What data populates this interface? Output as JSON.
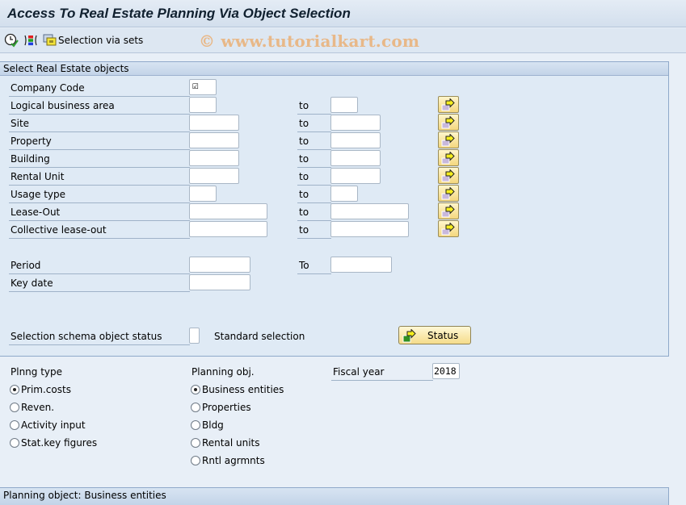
{
  "window": {
    "title": "Access To Real Estate Planning Via Object Selection"
  },
  "toolbar": {
    "execute_icon": "clock-check-icon",
    "selection_options_icon": "multicolor-selection-icon",
    "sets_icon": "selection-sets-icon",
    "selection_via_sets_label": "Selection via sets",
    "watermark": "© www.tutorialkart.com"
  },
  "select_objects": {
    "header": "Select Real Estate objects",
    "to_label": "to",
    "rows": [
      {
        "label": "Company Code",
        "from": "",
        "to": null,
        "checkbox": true
      },
      {
        "label": "Logical business area",
        "from": "",
        "to": ""
      },
      {
        "label": "Site",
        "from": "",
        "to": ""
      },
      {
        "label": "Property",
        "from": "",
        "to": ""
      },
      {
        "label": "Building",
        "from": "",
        "to": ""
      },
      {
        "label": "Rental Unit",
        "from": "",
        "to": ""
      },
      {
        "label": "Usage type",
        "from": "",
        "to": ""
      },
      {
        "label": "Lease-Out",
        "from": "",
        "to": ""
      },
      {
        "label": "Collective lease-out",
        "from": "",
        "to": ""
      }
    ],
    "period_label": "Period",
    "period_from": "",
    "period_to_label": "To",
    "period_to": "",
    "key_date_label": "Key date",
    "key_date": "",
    "schema_label": "Selection schema object status",
    "schema_value": "",
    "schema_text": "Standard selection",
    "status_button": "Status"
  },
  "planning_type": {
    "label": "Plnng type",
    "selected": "Prim.costs",
    "options": [
      "Prim.costs",
      "Reven.",
      "Activity input",
      "Stat.key figures"
    ]
  },
  "planning_obj": {
    "label": "Planning obj.",
    "selected": "Business entities",
    "options": [
      "Business entities",
      "Properties",
      "Bldg",
      "Rental units",
      "Rntl agrmnts"
    ]
  },
  "fiscal_year": {
    "label": "Fiscal year",
    "value": "2018"
  },
  "bottom_section": {
    "header": "Planning object: Business entities"
  }
}
